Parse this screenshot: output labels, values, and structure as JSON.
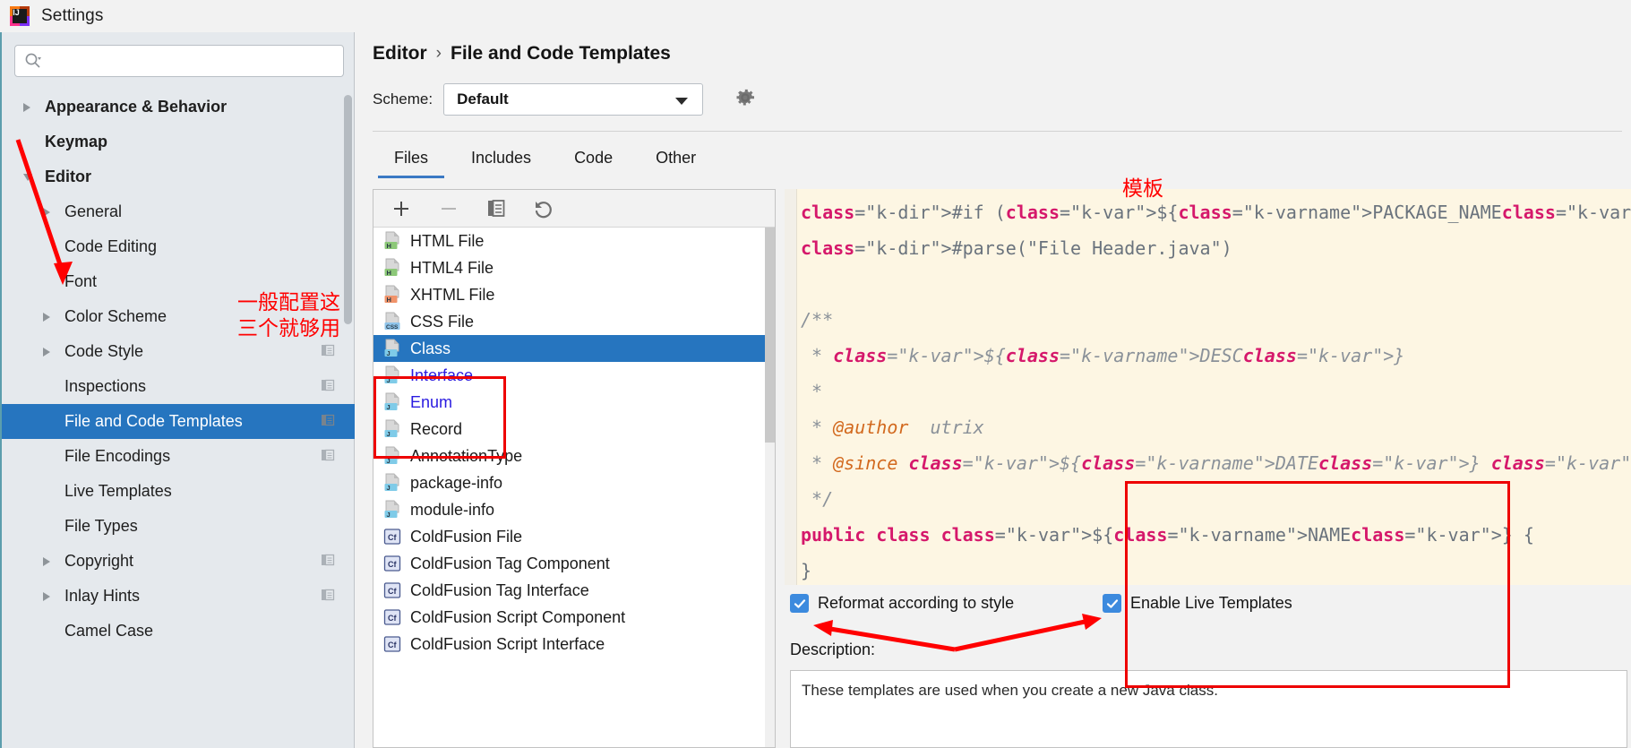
{
  "window": {
    "title": "Settings",
    "logo_text": "IJ"
  },
  "search": {
    "placeholder": "",
    "value": "",
    "icon": "search-icon"
  },
  "sidebar": {
    "items": [
      {
        "label": "Appearance & Behavior",
        "level": 0,
        "arrow": "collapsed",
        "selected": false,
        "badge": false
      },
      {
        "label": "Keymap",
        "level": 0,
        "arrow": "none",
        "selected": false,
        "badge": false
      },
      {
        "label": "Editor",
        "level": 0,
        "arrow": "expanded",
        "selected": false,
        "badge": false
      },
      {
        "label": "General",
        "level": 1,
        "arrow": "collapsed",
        "selected": false,
        "badge": false
      },
      {
        "label": "Code Editing",
        "level": 1,
        "arrow": "none",
        "selected": false,
        "badge": false
      },
      {
        "label": "Font",
        "level": 1,
        "arrow": "none",
        "selected": false,
        "badge": false
      },
      {
        "label": "Color Scheme",
        "level": 1,
        "arrow": "collapsed",
        "selected": false,
        "badge": false
      },
      {
        "label": "Code Style",
        "level": 1,
        "arrow": "collapsed",
        "selected": false,
        "badge": true
      },
      {
        "label": "Inspections",
        "level": 1,
        "arrow": "none",
        "selected": false,
        "badge": true
      },
      {
        "label": "File and Code Templates",
        "level": 1,
        "arrow": "none",
        "selected": true,
        "badge": true
      },
      {
        "label": "File Encodings",
        "level": 1,
        "arrow": "none",
        "selected": false,
        "badge": true
      },
      {
        "label": "Live Templates",
        "level": 1,
        "arrow": "none",
        "selected": false,
        "badge": false
      },
      {
        "label": "File Types",
        "level": 1,
        "arrow": "none",
        "selected": false,
        "badge": false
      },
      {
        "label": "Copyright",
        "level": 1,
        "arrow": "collapsed",
        "selected": false,
        "badge": true
      },
      {
        "label": "Inlay Hints",
        "level": 1,
        "arrow": "collapsed",
        "selected": false,
        "badge": true
      },
      {
        "label": "Camel Case",
        "level": 1,
        "arrow": "none",
        "selected": false,
        "badge": false
      }
    ]
  },
  "header": {
    "breadcrumb_parent": "Editor",
    "breadcrumb_sep": "›",
    "breadcrumb_current": "File and Code Templates",
    "scheme_label": "Scheme:",
    "scheme_value": "Default",
    "gear_icon": "gear-icon"
  },
  "tabs": [
    {
      "label": "Files",
      "active": true
    },
    {
      "label": "Includes",
      "active": false
    },
    {
      "label": "Code",
      "active": false
    },
    {
      "label": "Other",
      "active": false
    }
  ],
  "list_toolbar": [
    {
      "name": "add-template-button",
      "icon": "plus-icon"
    },
    {
      "name": "remove-template-button",
      "icon": "minus-icon"
    },
    {
      "name": "copy-template-button",
      "icon": "copy-icon"
    },
    {
      "name": "reset-template-button",
      "icon": "undo-icon"
    }
  ],
  "templates": [
    {
      "label": "HTML File",
      "icon": "html-file-icon",
      "badge": "H",
      "badge_color": "#8cc878",
      "state": "normal"
    },
    {
      "label": "HTML4 File",
      "icon": "html4-file-icon",
      "badge": "H",
      "badge_color": "#8cc878",
      "state": "normal"
    },
    {
      "label": "XHTML File",
      "icon": "xhtml-file-icon",
      "badge": "H",
      "badge_color": "#f0936a",
      "state": "normal"
    },
    {
      "label": "CSS File",
      "icon": "css-file-icon",
      "badge": "CSS",
      "badge_color": "#8fc4ea",
      "state": "normal"
    },
    {
      "label": "Class",
      "icon": "java-class-icon",
      "badge": "J",
      "badge_color": "#7fcbe8",
      "state": "selected"
    },
    {
      "label": "Interface",
      "icon": "java-interface-icon",
      "badge": "J",
      "badge_color": "#7fcbe8",
      "state": "modified"
    },
    {
      "label": "Enum",
      "icon": "java-enum-icon",
      "badge": "J",
      "badge_color": "#7fcbe8",
      "state": "modified"
    },
    {
      "label": "Record",
      "icon": "java-record-icon",
      "badge": "J",
      "badge_color": "#7fcbe8",
      "state": "normal"
    },
    {
      "label": "AnnotationType",
      "icon": "java-annotation-icon",
      "badge": "J",
      "badge_color": "#7fcbe8",
      "state": "normal"
    },
    {
      "label": "package-info",
      "icon": "java-package-icon",
      "badge": "J",
      "badge_color": "#7fcbe8",
      "state": "normal"
    },
    {
      "label": "module-info",
      "icon": "java-module-icon",
      "badge": "J",
      "badge_color": "#7fcbe8",
      "state": "normal"
    },
    {
      "label": "ColdFusion File",
      "icon": "coldfusion-icon",
      "badge": "Cf",
      "badge_color": "#dfe4f5",
      "state": "normal"
    },
    {
      "label": "ColdFusion Tag Component",
      "icon": "coldfusion-icon",
      "badge": "Cf",
      "badge_color": "#dfe4f5",
      "state": "normal"
    },
    {
      "label": "ColdFusion Tag Interface",
      "icon": "coldfusion-icon",
      "badge": "Cf",
      "badge_color": "#dfe4f5",
      "state": "normal"
    },
    {
      "label": "ColdFusion Script Component",
      "icon": "coldfusion-icon",
      "badge": "Cf",
      "badge_color": "#dfe4f5",
      "state": "normal"
    },
    {
      "label": "ColdFusion Script Interface",
      "icon": "coldfusion-icon",
      "badge": "Cf",
      "badge_color": "#dfe4f5",
      "state": "normal"
    }
  ],
  "editor": {
    "lines": [
      "#if (${PACKAGE_NAME} && ${PACKAGE_NAME} != \"\")package ${PACKAGE_NAME};#end",
      "#parse(\"File Header.java\")",
      "",
      "/**",
      " * ${DESC}",
      " *",
      " * @author  utrix",
      " * @since ${DATE} ${TIME}",
      " */",
      "public class ${NAME} {",
      "}"
    ]
  },
  "options": {
    "reformat": {
      "label": "Reformat according to style",
      "checked": true
    },
    "live_templates": {
      "label": "Enable Live Templates",
      "checked": true
    },
    "description_label": "Description:",
    "description_text": "These templates are used when you create a new Java class."
  },
  "annotations": {
    "sidebar_note": "一般配置这\n三个就够用",
    "template_note": "模板"
  },
  "colors": {
    "selection_blue": "#2675bf",
    "annotation_red": "#ff0000",
    "editor_bg": "#fdf6e3",
    "sidebar_bg": "#e5e9ed"
  }
}
